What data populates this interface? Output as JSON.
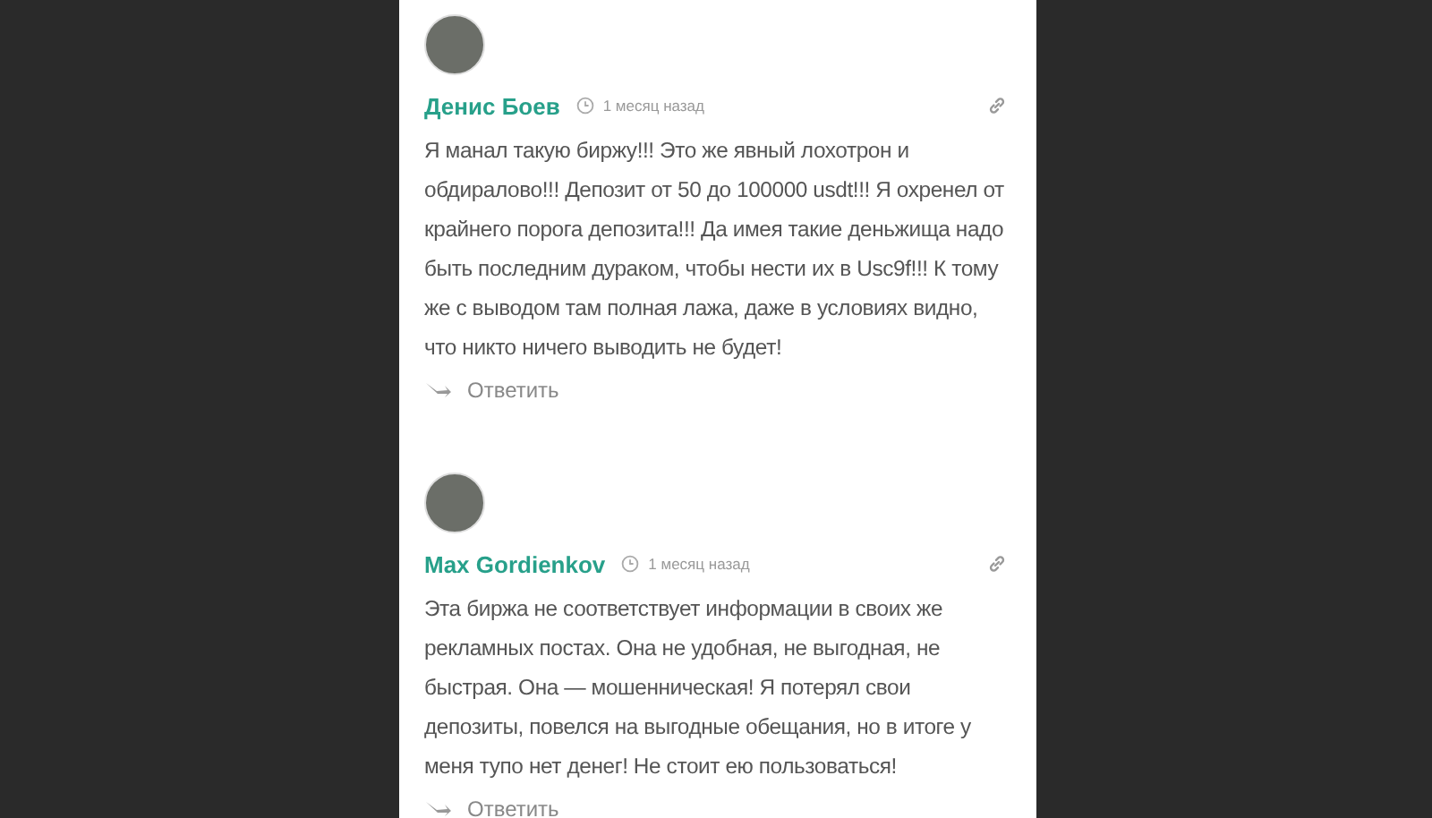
{
  "comments": [
    {
      "author": "Денис Боев",
      "time": "1 месяц назад",
      "text": "Я манал такую биржу!!! Это же явный лохотрон и обдиралово!!! Депозит от 50 до 100000 usdt!!! Я охренел от крайнего порога депозита!!! Да имея такие деньжища надо быть последним дураком, чтобы нести их в Usc9f!!! К тому же с выводом там полная лажа, даже в условиях видно, что никто ничего выводить не будет!",
      "reply": "Ответить"
    },
    {
      "author": "Max Gordienkov",
      "time": "1 месяц назад",
      "text": "Эта биржа не соответствует информации в своих же рекламных постах. Она не удобная, не выгодная, не быстрая. Она — мошенническая! Я потерял свои депозиты, повелся на выгодные обещания, но в итоге у меня тупо нет денег! Не стоит ею пользоваться!",
      "reply": "Ответить"
    }
  ]
}
